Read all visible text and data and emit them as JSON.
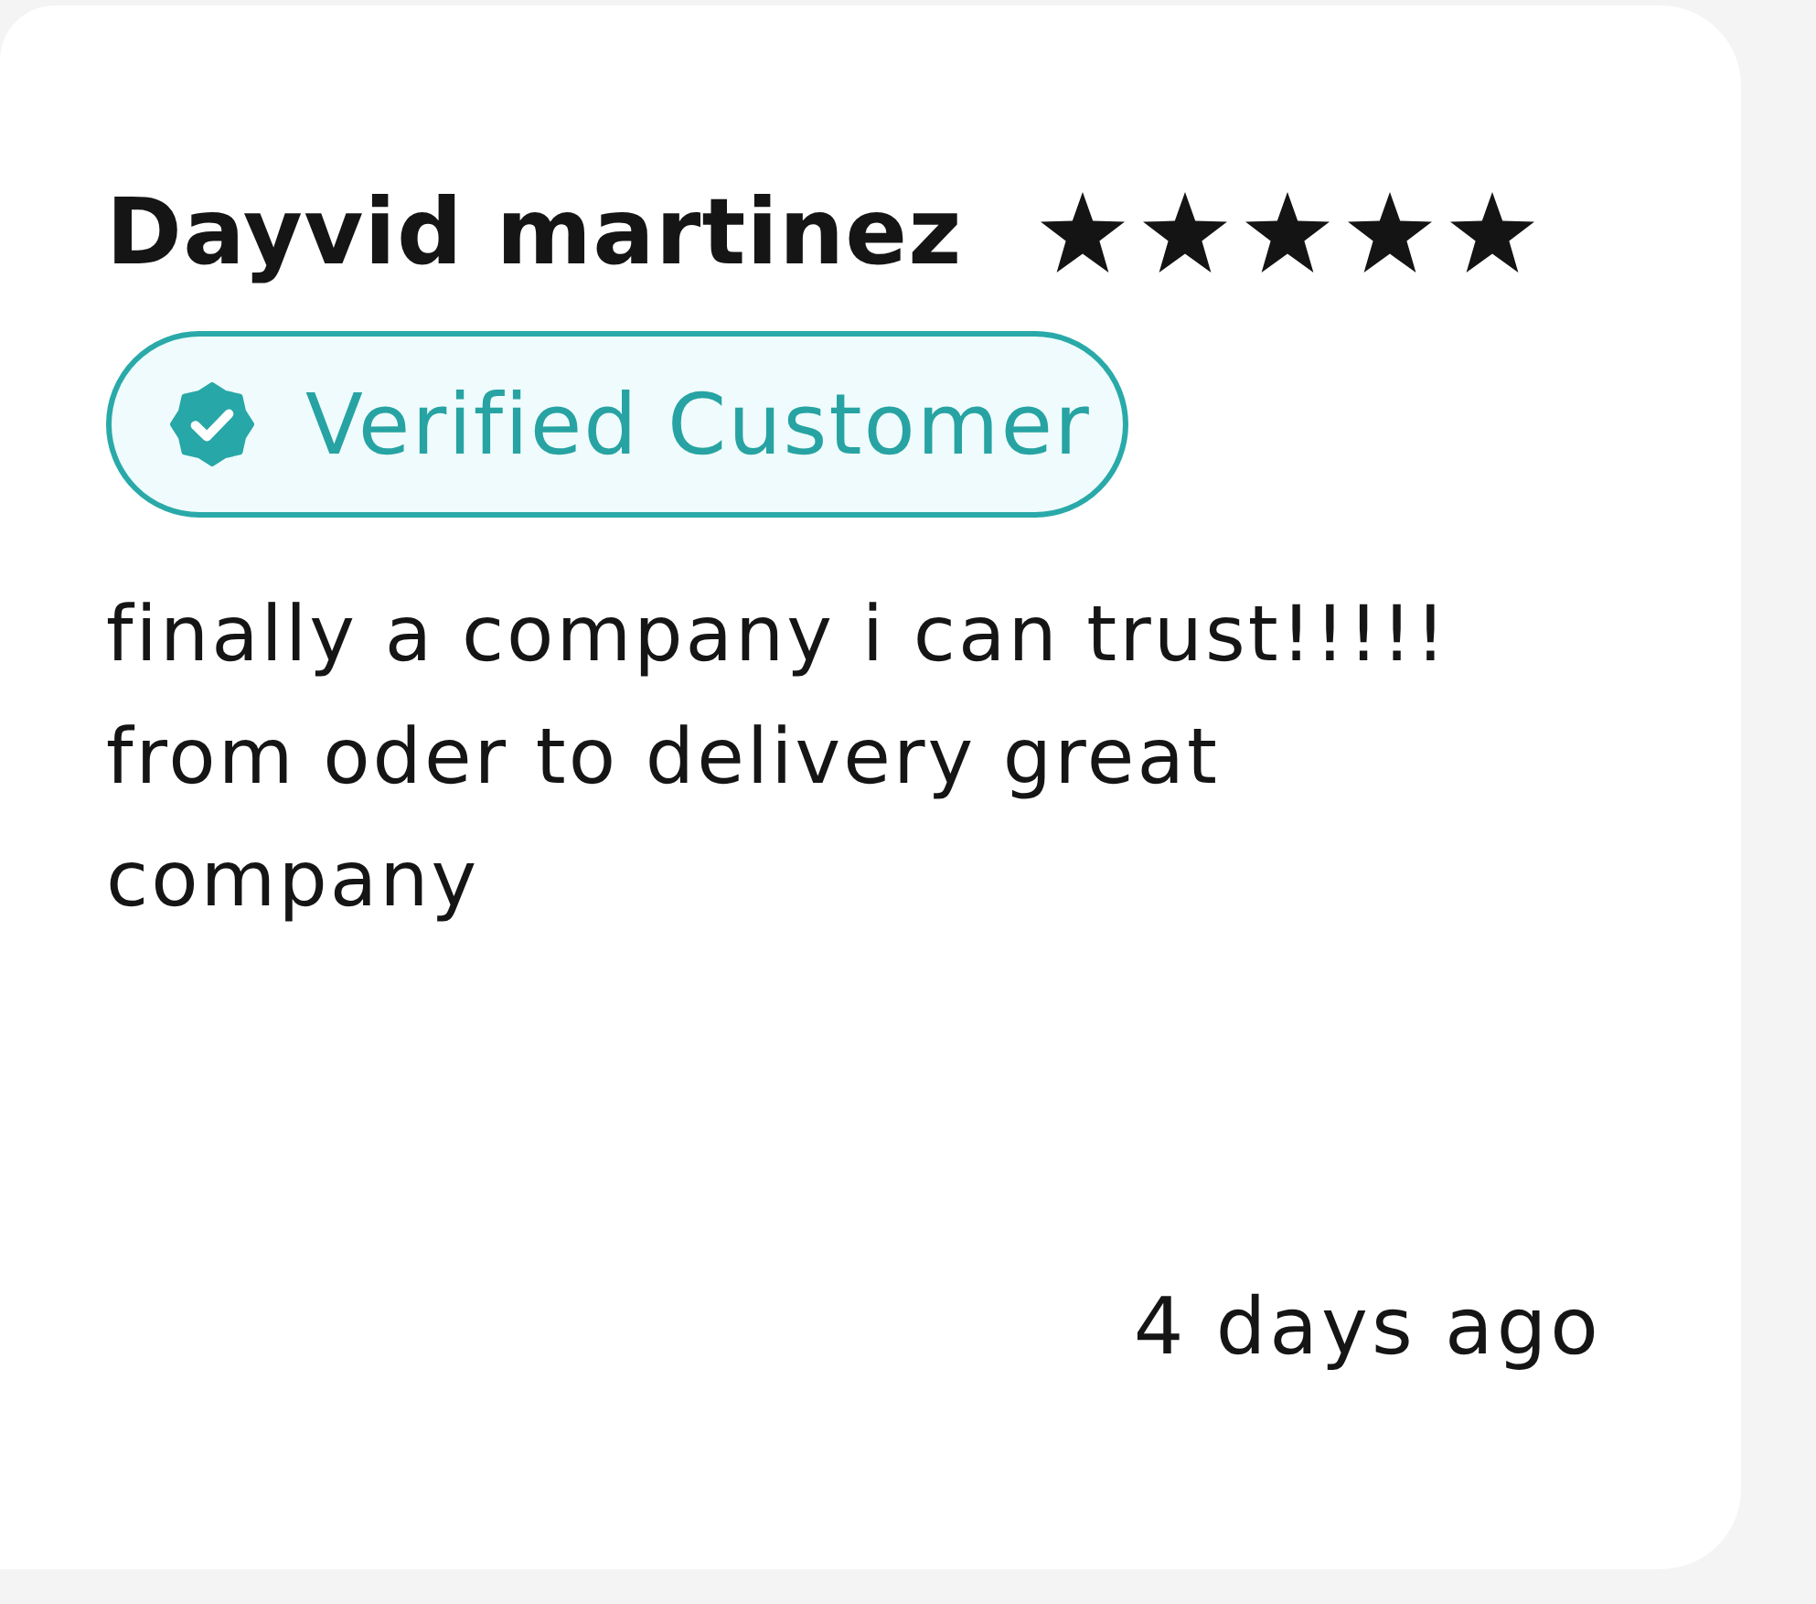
{
  "review": {
    "author": "Dayvid martinez",
    "stars": 5,
    "badge": {
      "label": "Verified Customer"
    },
    "text": "finally a company i can trust!!!!! from oder to delivery great company",
    "time": "4 days ago"
  }
}
